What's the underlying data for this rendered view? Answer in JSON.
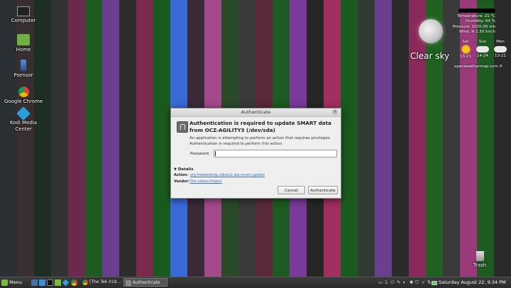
{
  "desktop": {
    "icons": [
      {
        "label": "Computer"
      },
      {
        "label": "Home"
      },
      {
        "label": "Psensor"
      },
      {
        "label": "Google Chrome"
      },
      {
        "label": "Kodi Media Center"
      },
      {
        "label": "Trash"
      }
    ],
    "stripe_colors": [
      "#2a2f33",
      "#3a2f30",
      "#1f2e25",
      "#333333",
      "#6a2a4e",
      "#1e5a22",
      "#6a3f8e",
      "#2c2c2c",
      "#7a2a4a",
      "#1b5a1f",
      "#3a6ad8",
      "#3b2a3a",
      "#a34a8a",
      "#2a4a2a",
      "#3a3a3a",
      "#5a2a3a",
      "#1e5a22",
      "#7a3a9a",
      "#262626",
      "#a12f5f",
      "#1b5a1f",
      "#333a33",
      "#6a3f8e",
      "#2b2b2b",
      "#8a2a5a",
      "#206020",
      "#3a3a3a",
      "#9a3a7a",
      "#1e5a22",
      "#2a2a2a"
    ]
  },
  "weather": {
    "temperature": "Temperature: 21 °C",
    "humidity": "Humidity: 64 %",
    "pressure": "Pressure: 1020.00 mb",
    "wind": "Wind: N 1.50 km/h",
    "condition": "Clear sky",
    "forecast": [
      {
        "day": "Sat",
        "range": "13-21",
        "icon": "sun-icon"
      },
      {
        "day": "Sun",
        "range": "14-24",
        "icon": "cloud-icon"
      },
      {
        "day": "Mon",
        "range": "13-21",
        "icon": "cloud-icon"
      }
    ],
    "provider": "openweathermap.com"
  },
  "dialog": {
    "title": "Authenticate",
    "heading": "Authentication is required to update SMART data from OCZ-AGILITY3 (/dev/sda)",
    "body_line1": "An application is attempting to perform an action that requires privileges.",
    "body_line2": "Authentication is required to perform this action.",
    "password_label": "Password:",
    "password_value": "",
    "details_label": "Details",
    "action_key": "Action:",
    "action_value": "org.freedesktop.udisks2.ata-smart-update",
    "vendor_key": "Vendor:",
    "vendor_value": "The udisks Project",
    "cancel_label": "Cancel",
    "authenticate_label": "Authenticate"
  },
  "taskbar": {
    "menu_label": "Menu",
    "tasks": [
      {
        "label": "[The Tek 019..."
      },
      {
        "label": "Authenticate"
      }
    ],
    "clock": "Saturday August 22,  9:34 PM"
  }
}
